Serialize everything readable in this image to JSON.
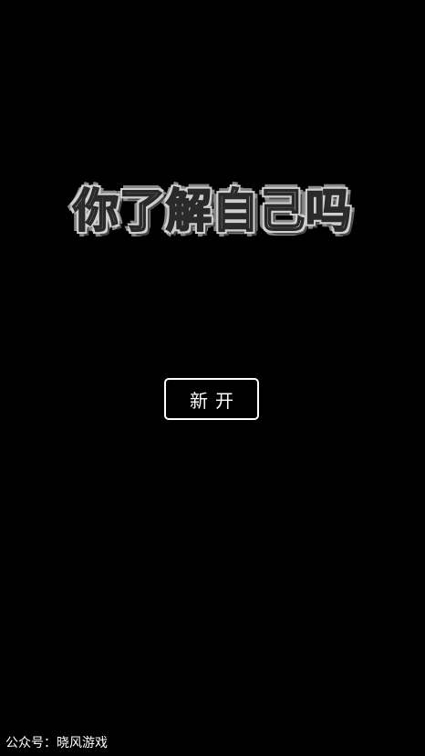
{
  "title": "你了解自己吗",
  "start_button_label": "新开",
  "footer_credit": "公众号：晓风游戏",
  "colors": {
    "background": "#000000",
    "text": "#ffffff",
    "button_border": "#ffffff"
  }
}
